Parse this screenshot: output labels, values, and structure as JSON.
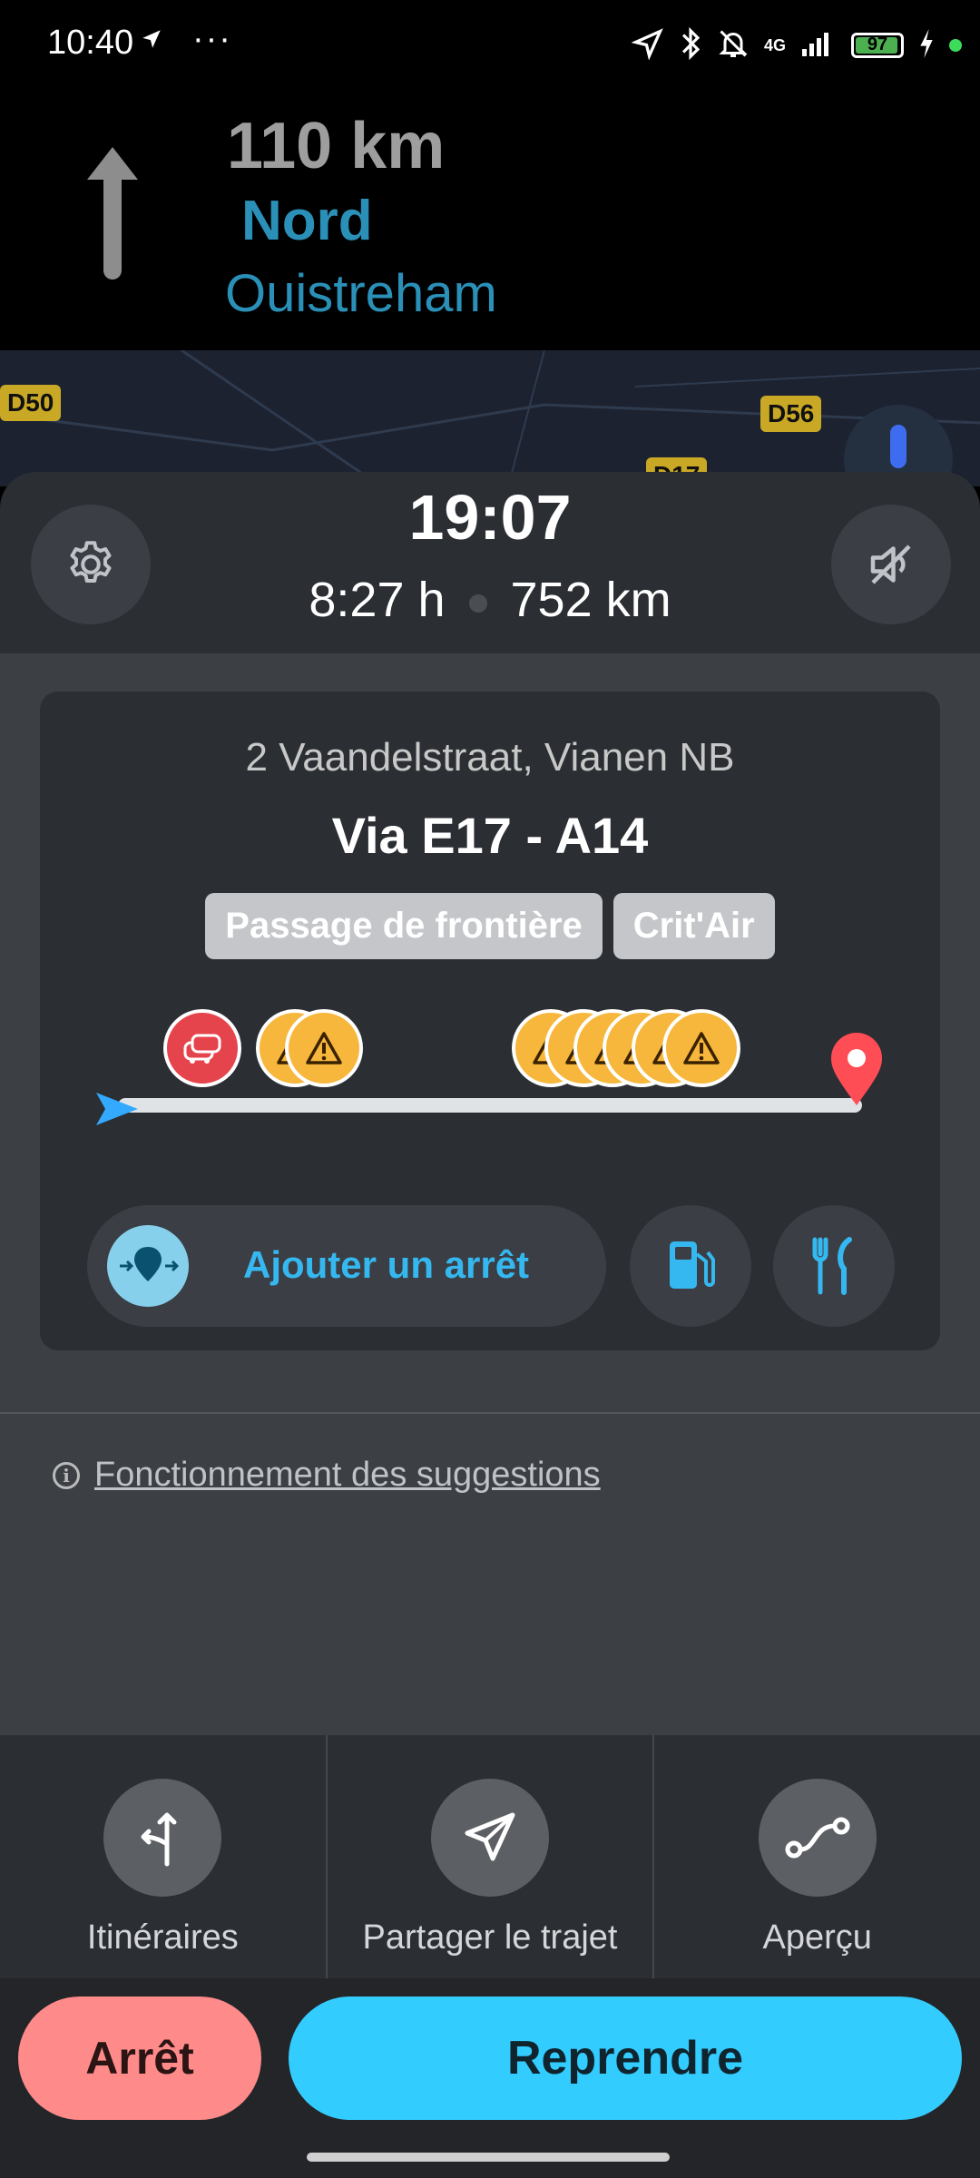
{
  "status_bar": {
    "time": "10:40",
    "more": "···",
    "network": "4G",
    "battery_level": "97",
    "icons": [
      "location-arrow-icon",
      "bluetooth-icon",
      "bell-off-icon",
      "signal-icon",
      "battery-icon",
      "charging-icon"
    ]
  },
  "navigation": {
    "distance": "110 km",
    "street": "Nord",
    "city": "Ouistreham",
    "maneuver_icon": "straight-arrow-icon"
  },
  "map": {
    "road_labels": [
      "D50",
      "D56",
      "D17"
    ]
  },
  "trip": {
    "arrival_time": "19:07",
    "duration": "8:27 h",
    "distance": "752 km"
  },
  "route_card": {
    "address": "2 Vaandelstraat, Vianen NB",
    "via": "Via E17 - A14",
    "tags": [
      "Passage de frontière",
      "Crit'Air"
    ],
    "add_stop_label": "Ajouter un arrêt"
  },
  "info_link": "Fonctionnement des suggestions",
  "actions": [
    {
      "label": "Itinéraires",
      "icon": "routes-icon"
    },
    {
      "label": "Partager le trajet",
      "icon": "share-send-icon"
    },
    {
      "label": "Aperçu",
      "icon": "overview-route-icon"
    }
  ],
  "buttons": {
    "stop": "Arrêt",
    "resume": "Reprendre"
  },
  "colors": {
    "accent_blue": "#33ccff",
    "stop_red": "#ff8a8a",
    "warning_orange": "#f6b73c",
    "jam_red": "#e6444d"
  }
}
